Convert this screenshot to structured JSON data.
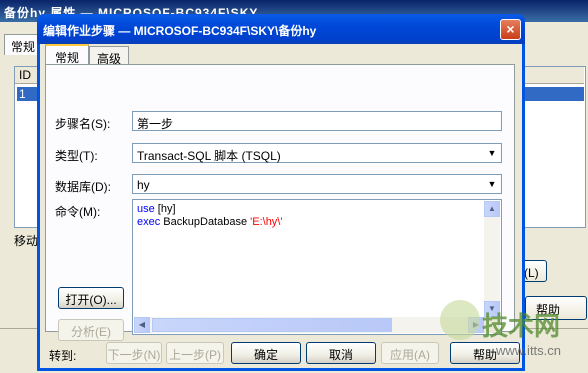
{
  "background_window": {
    "title": "备份hy 属性 — MICROSOF-BC934F\\SKY",
    "tab": "常规",
    "list_header": "ID",
    "list_row_id": "1",
    "move_label": "移动",
    "partial_button": "除(L)",
    "help_button": "帮助"
  },
  "dialog": {
    "title": "编辑作业步骤 — MICROSOF-BC934F\\SKY\\备份hy",
    "close_icon": "×",
    "tabs": [
      "常规",
      "高级"
    ],
    "step_name_label": "步骤名(S):",
    "step_name_value": "第一步",
    "type_label": "类型(T):",
    "type_value": "Transact-SQL 脚本 (TSQL)",
    "database_label": "数据库(D):",
    "database_value": "hy",
    "command_label": "命令(M):",
    "command": {
      "line1_kw": "use",
      "line1_rest": " [hy]",
      "line2_kw": "exec",
      "line2_mid": " BackupDatabase ",
      "line2_str": "'E:\\hy\\'"
    },
    "open_button": "打开(O)...",
    "parse_button": "分析(E)",
    "goto_label": "转到:",
    "next_step_button": "下一步(N)",
    "prev_step_button": "上一步(P)",
    "ok_button": "确定",
    "cancel_button": "取消",
    "apply_button": "应用(A)",
    "help_button": "帮助"
  },
  "watermark": {
    "brand": "技术网",
    "url": "www.itts.cn"
  }
}
